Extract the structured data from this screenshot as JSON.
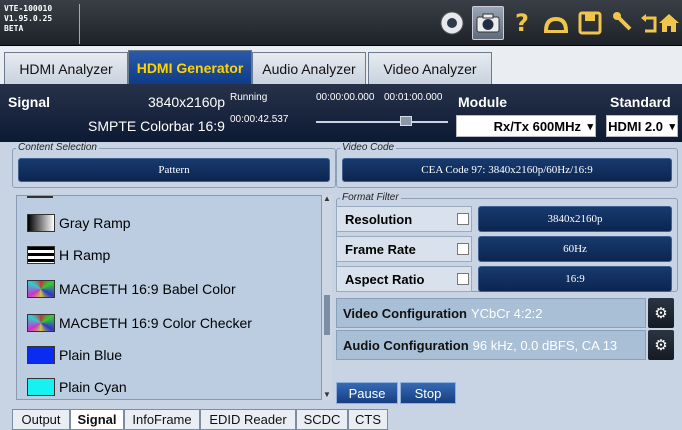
{
  "version": {
    "line1": "VTE-100010",
    "line2": "V1.95.0.25",
    "line3": "BETA"
  },
  "toolbar": {
    "icons": [
      "record-icon",
      "camera-icon",
      "help-icon",
      "cloud-icon",
      "save-icon",
      "wrench-icon",
      "back-icon",
      "home-icon"
    ],
    "help": "?"
  },
  "tabs": [
    "HDMI Analyzer",
    "HDMI Generator",
    "Audio Analyzer",
    "Video Analyzer"
  ],
  "signal": {
    "label": "Signal",
    "resolution": "3840x2160p",
    "state": "Running",
    "time_start": "00:00:00.000",
    "time_end": "00:01:00.000",
    "pattern_name": "SMPTE Colorbar 16:9",
    "elapsed": "00:00:42.537",
    "module_label": "Module",
    "module_value": "Rx/Tx 600MHz",
    "standard_label": "Standard",
    "standard_value": "HDMI 2.0"
  },
  "content_selection": {
    "label": "Content Selection",
    "value": "Pattern"
  },
  "video_code": {
    "label": "Video Code",
    "value": "CEA Code 97: 3840x2160p/60Hz/16:9"
  },
  "patterns": [
    {
      "name": "Gray Ramp",
      "swatch": "gray-ramp"
    },
    {
      "name": "H Ramp",
      "swatch": "h-ramp"
    },
    {
      "name": "MACBETH 16:9 Babel Color",
      "swatch": "macbeth"
    },
    {
      "name": "MACBETH 16:9 Color Checker",
      "swatch": "macbeth"
    },
    {
      "name": "Plain Blue",
      "swatch": "#0a2cf0"
    },
    {
      "name": "Plain Cyan",
      "swatch": "#16f2f2"
    }
  ],
  "format_filter": {
    "label": "Format Filter",
    "rows": [
      {
        "label": "Resolution",
        "value": "3840x2160p"
      },
      {
        "label": "Frame Rate",
        "value": "60Hz"
      },
      {
        "label": "Aspect Ratio",
        "value": "16:9"
      }
    ]
  },
  "video_config": {
    "label": "Video Configuration",
    "value": "YCbCr 4:2:2"
  },
  "audio_config": {
    "label": "Audio Configuration",
    "value": "96 kHz, 0.0 dBFS, CA 13"
  },
  "actions": {
    "pause": "Pause",
    "stop": "Stop"
  },
  "bottom_tabs": [
    "Output",
    "Signal",
    "InfoFrame",
    "EDID Reader",
    "SCDC",
    "CTS"
  ]
}
